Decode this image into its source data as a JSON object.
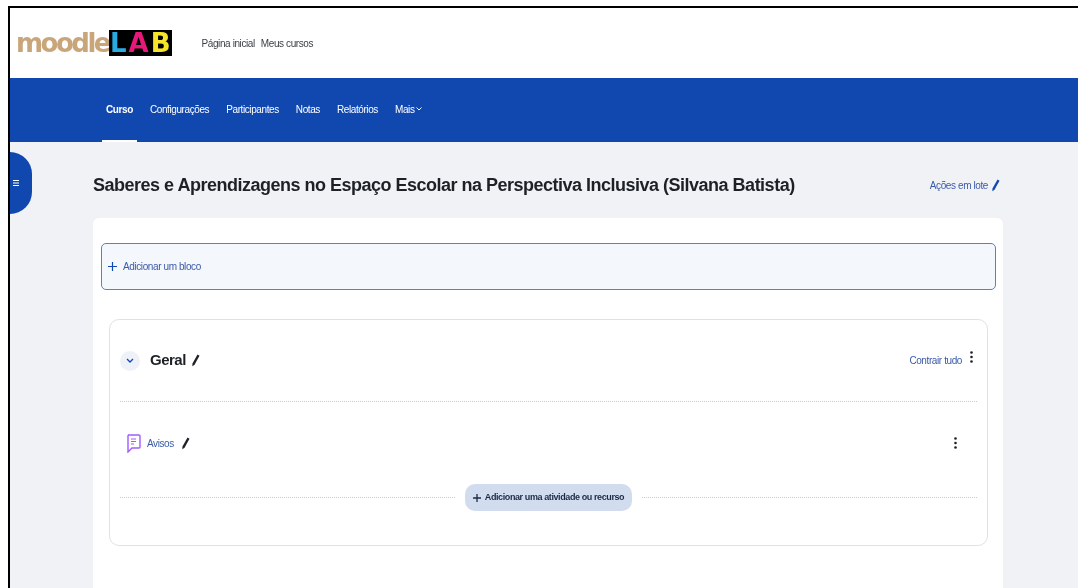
{
  "logo": {
    "word": "moodle",
    "letters": [
      "L",
      "A",
      "B"
    ]
  },
  "top_links": [
    "Página inicial",
    "Meus cursos"
  ],
  "course_nav": [
    {
      "label": "Curso",
      "selected": true
    },
    {
      "label": "Configurações",
      "selected": false
    },
    {
      "label": "Participantes",
      "selected": false
    },
    {
      "label": "Notas",
      "selected": false
    },
    {
      "label": "Relatórios",
      "selected": false
    },
    {
      "label": "Mais",
      "selected": false,
      "dropdown": true
    }
  ],
  "course_title": "Saberes e Aprendizagens no Espaço Escolar na Perspectiva Inclusiva (Silvana Batista)",
  "bulk_actions": "Ações em lote",
  "add_block": "Adicionar um bloco",
  "section": {
    "title": "Geral",
    "expanded": true,
    "collapse_all": "Contrair tudo",
    "activities": [
      {
        "name": "Avisos"
      }
    ],
    "add_activity": "Adicionar uma atividade ou recurso"
  }
}
